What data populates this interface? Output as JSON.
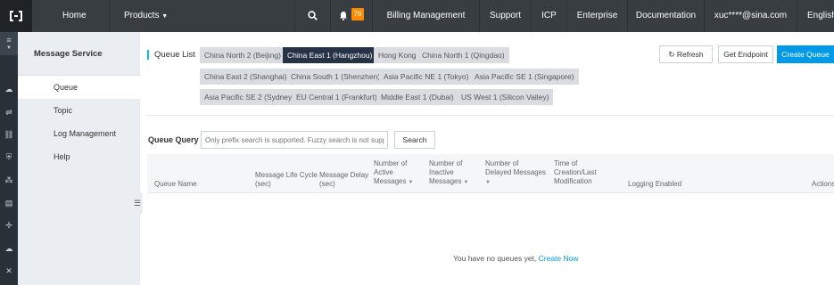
{
  "topbar": {
    "home": "Home",
    "products": "Products",
    "notification_count": "76",
    "billing": "Billing Management",
    "support": "Support",
    "icp": "ICP",
    "enterprise": "Enterprise",
    "documentation": "Documentation",
    "user": "xuc****@sina.com",
    "language": "English"
  },
  "sidebar": {
    "title": "Message Service",
    "items": [
      {
        "label": "Queue"
      },
      {
        "label": "Topic"
      },
      {
        "label": "Log Management"
      },
      {
        "label": "Help"
      }
    ]
  },
  "queue_list": {
    "label": "Queue List",
    "regions_row1": [
      "China North 2 (Beijing)",
      "China East 1 (Hangzhou)",
      "Hong Kong",
      "China North 1 (Qingdao)"
    ],
    "regions_row2": [
      "China East 2 (Shanghai)",
      "China South 1 (Shenzhen)",
      "Asia Pacific NE 1 (Tokyo)",
      "Asia Pacific SE 1 (Singapore)"
    ],
    "regions_row3": [
      "Asia Pacific SE 2 (Sydney)",
      "EU Central 1 (Frankfurt)",
      "Middle East 1 (Dubai)",
      "US West 1 (Silicon Valley)"
    ],
    "selected_region": "China East 1 (Hangzhou)"
  },
  "actions": {
    "refresh": "Refresh",
    "get_endpoint": "Get Endpoint",
    "create_queue": "Create Queue"
  },
  "query": {
    "label": "Queue Query :",
    "placeholder": "Only prefix search is supported. Fuzzy search is not supported.",
    "search": "Search"
  },
  "table": {
    "columns": {
      "queue_name": "Queue Name",
      "life_cycle": [
        "Message Life Cycle",
        "(sec)"
      ],
      "delay": [
        "Message Delay",
        "(sec)"
      ],
      "active": [
        "Number of",
        "Active",
        "Messages"
      ],
      "inactive": [
        "Number of",
        "Inactive",
        "Messages"
      ],
      "delayed": [
        "Number of",
        "Delayed Messages"
      ],
      "time": [
        "Time of",
        "Creation/Last",
        "Modification"
      ],
      "logging": "Logging Enabled",
      "actions": "Actions"
    },
    "empty_text": "You have no queues yet,",
    "empty_link": "Create Now"
  },
  "colors": {
    "topbar": "#373d41",
    "accent": "#0099e8",
    "selected_region": "#263245",
    "notification": "#ff8a00"
  }
}
